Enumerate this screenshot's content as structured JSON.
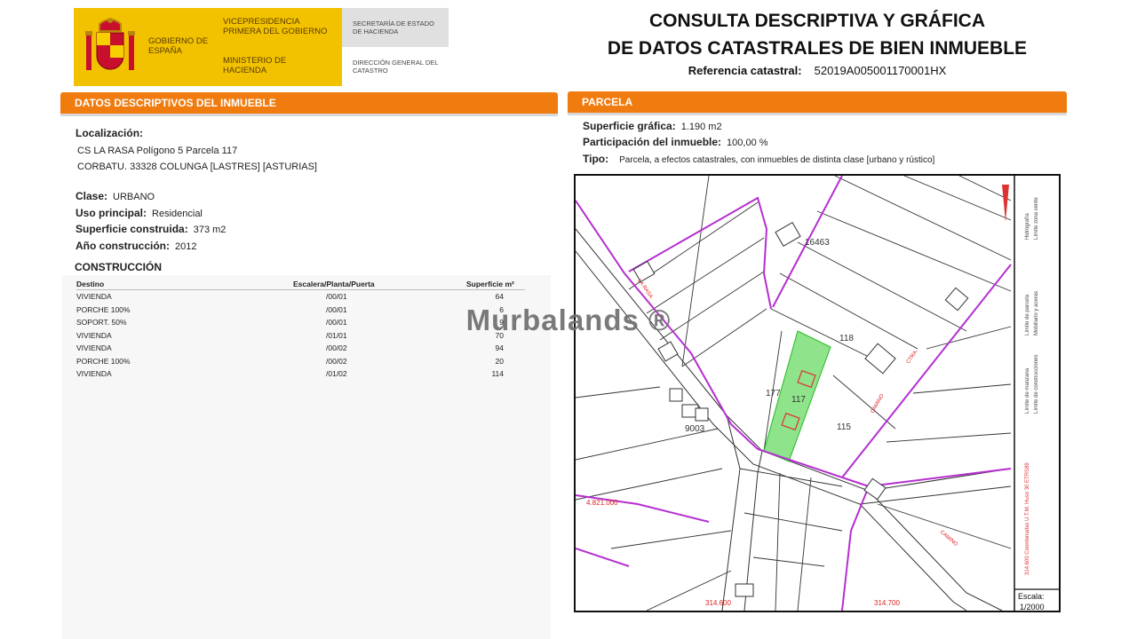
{
  "header": {
    "gobierno": "GOBIERNO DE ESPAÑA",
    "vicepresidencia": "VICEPRESIDENCIA PRIMERA DEL GOBIERNO",
    "ministerio": "MINISTERIO DE HACIENDA",
    "secretaria": "SECRETARÍA DE ESTADO DE HACIENDA",
    "direccion": "DIRECCIÓN GENERAL DEL CATASTRO",
    "title_line1": "CONSULTA DESCRIPTIVA Y GRÁFICA",
    "title_line2": "DE DATOS CATASTRALES DE BIEN INMUEBLE",
    "ref_label": "Referencia catastral:",
    "ref_value": "52019A005001170001HX"
  },
  "left": {
    "bar_title": "DATOS DESCRIPTIVOS DEL INMUEBLE",
    "localizacion_label": "Localización:",
    "loc_line1": "CS LA RASA  Polígono 5 Parcela 117",
    "loc_line2": "CORBATU. 33328 COLUNGA [LASTRES] [ASTURIAS]",
    "clase_label": "Clase:",
    "clase_value": "URBANO",
    "uso_label": "Uso principal:",
    "uso_value": "Residencial",
    "sup_label": "Superficie construida:",
    "sup_value": "373 m2",
    "ano_label": "Año construcción:",
    "ano_value": "2012",
    "construccion_label": "CONSTRUCCIÓN",
    "table_headers": [
      "Destino",
      "Escalera/Planta/Puerta",
      "Superficie m²"
    ],
    "rows": [
      [
        "VIVIENDA",
        "/00/01",
        "64"
      ],
      [
        "PORCHE 100%",
        "/00/01",
        "6"
      ],
      [
        "SOPORT. 50%",
        "/00/01",
        "9"
      ],
      [
        "VIVIENDA",
        "/01/01",
        "70"
      ],
      [
        "VIVIENDA",
        "/00/02",
        "94"
      ],
      [
        "PORCHE 100%",
        "/00/02",
        "20"
      ],
      [
        "VIVIENDA",
        "/01/02",
        "114"
      ]
    ]
  },
  "right": {
    "bar_title": "PARCELA",
    "sup_grafica_label": "Superficie gráfica:",
    "sup_grafica_value": "1.190 m2",
    "participacion_label": "Participación del inmueble:",
    "participacion_value": "100,00 %",
    "tipo_label": "Tipo:",
    "tipo_value": "Parcela, a efectos catastrales, con inmuebles de distinta clase [urbano y rústico]"
  },
  "map": {
    "parcel_labels": [
      "16463",
      "118",
      "177",
      "117",
      "115",
      "9003"
    ],
    "coord_y": "4.821.000",
    "coord_x1": "314.600",
    "coord_x2": "314.700",
    "escala_label": "Escala:",
    "escala_value": "1/2000",
    "legend_items": [
      "Límite de parcela",
      "Hidrografía",
      "Límite zona verde",
      "Mobiliario y aceras",
      "Límite de construcciones",
      "Límite de manzana"
    ],
    "utm_note": "314.600 Coordenadas U.T.M. Huso 30 ETRS89",
    "street_labels": [
      "LA RASA",
      "CAMINO",
      "CAMINO",
      "CTRA."
    ],
    "colors": {
      "parcel_fill": "#8fe38a",
      "boundary": "#b52fd0",
      "building": "#d33"
    }
  },
  "watermark": "Murbalands ®"
}
